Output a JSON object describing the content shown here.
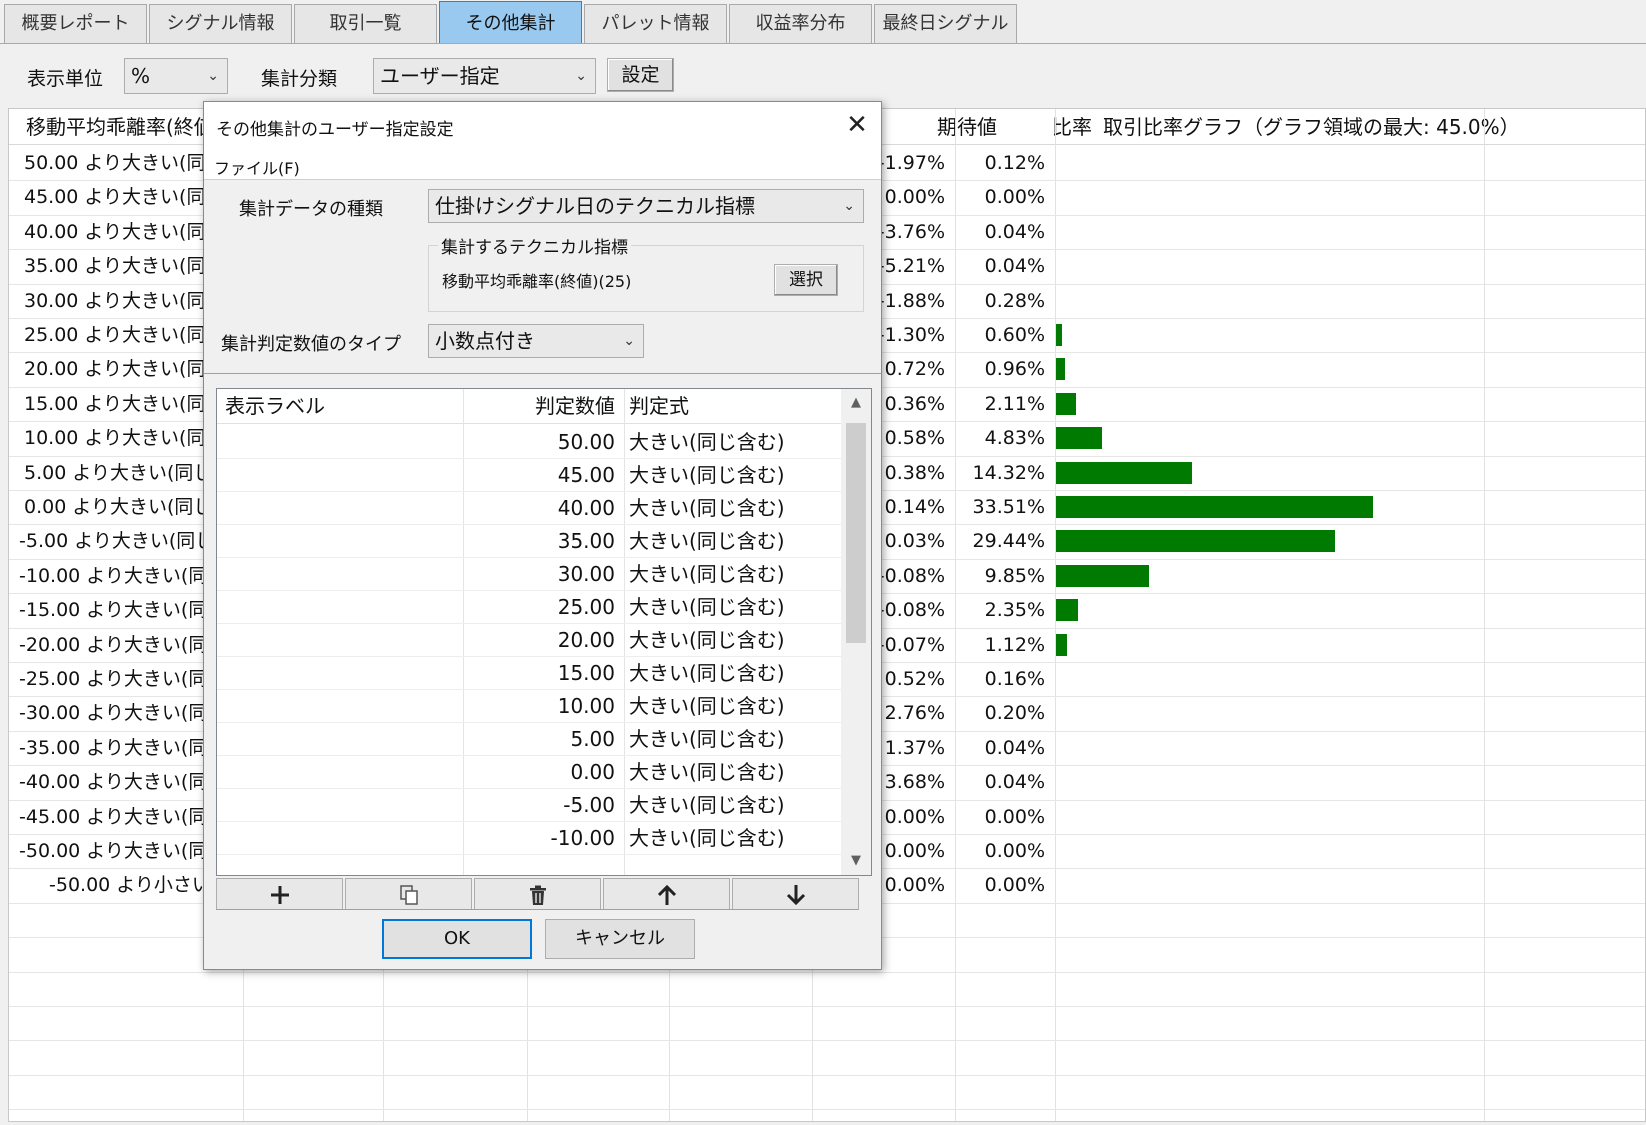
{
  "tabs": [
    "概要レポート",
    "シグナル情報",
    "取引一覧",
    "その他集計",
    "パレット情報",
    "収益率分布",
    "最終日シグナル"
  ],
  "active_tab": 3,
  "toolbar": {
    "unit_label": "表示単位",
    "unit_value": "%",
    "category_label": "集計分類",
    "category_value": "ユーザー指定",
    "settings_button": "設定"
  },
  "grid": {
    "headers": {
      "label": "移動平均乖離率(終値)(25)",
      "expected": "期待値",
      "ratio": "比率",
      "graph": "取引比率グラフ（グラフ領域の最大: 45.0%）"
    },
    "graph_max_pct": 45.0,
    "rows": [
      {
        "label": "50.00 より大きい(同じ含む)",
        "expected": "-1.97%",
        "ratio": "0.12%",
        "pct": 0.12
      },
      {
        "label": "45.00 より大きい(同じ含む)",
        "expected": "0.00%",
        "ratio": "0.00%",
        "pct": 0.0
      },
      {
        "label": "40.00 より大きい(同じ含む)",
        "expected": "-3.76%",
        "ratio": "0.04%",
        "pct": 0.04
      },
      {
        "label": "35.00 より大きい(同じ含む)",
        "expected": "-5.21%",
        "ratio": "0.04%",
        "pct": 0.04
      },
      {
        "label": "30.00 より大きい(同じ含む)",
        "expected": "-1.88%",
        "ratio": "0.28%",
        "pct": 0.28
      },
      {
        "label": "25.00 より大きい(同じ含む)",
        "expected": "-1.30%",
        "ratio": "0.60%",
        "pct": 0.6
      },
      {
        "label": "20.00 より大きい(同じ含む)",
        "expected": "0.72%",
        "ratio": "0.96%",
        "pct": 0.96
      },
      {
        "label": "15.00 より大きい(同じ含む)",
        "expected": "0.36%",
        "ratio": "2.11%",
        "pct": 2.11
      },
      {
        "label": "10.00 より大きい(同じ含む)",
        "expected": "0.58%",
        "ratio": "4.83%",
        "pct": 4.83
      },
      {
        "label": "5.00 より大きい(同じ含む)",
        "expected": "0.38%",
        "ratio": "14.32%",
        "pct": 14.32
      },
      {
        "label": "0.00 より大きい(同じ含む)",
        "expected": "0.14%",
        "ratio": "33.51%",
        "pct": 33.51
      },
      {
        "label": "-5.00 より大きい(同じ含む)",
        "expected": "0.03%",
        "ratio": "29.44%",
        "pct": 29.44
      },
      {
        "label": "-10.00 より大きい(同じ含む)",
        "expected": "-0.08%",
        "ratio": "9.85%",
        "pct": 9.85
      },
      {
        "label": "-15.00 より大きい(同じ含む)",
        "expected": "-0.08%",
        "ratio": "2.35%",
        "pct": 2.35
      },
      {
        "label": "-20.00 より大きい(同じ含む)",
        "expected": "-0.07%",
        "ratio": "1.12%",
        "pct": 1.12
      },
      {
        "label": "-25.00 より大きい(同じ含む)",
        "expected": "0.52%",
        "ratio": "0.16%",
        "pct": 0.16
      },
      {
        "label": "-30.00 より大きい(同じ含む)",
        "expected": "2.76%",
        "ratio": "0.20%",
        "pct": 0.2
      },
      {
        "label": "-35.00 より大きい(同じ含む)",
        "expected": "1.37%",
        "ratio": "0.04%",
        "pct": 0.04
      },
      {
        "label": "-40.00 より大きい(同じ含む)",
        "expected": "3.68%",
        "ratio": "0.04%",
        "pct": 0.04
      },
      {
        "label": "-45.00 より大きい(同じ含む)",
        "expected": "0.00%",
        "ratio": "0.00%",
        "pct": 0.0
      },
      {
        "label": "-50.00 より大きい(同じ含む)",
        "expected": "0.00%",
        "ratio": "0.00%",
        "pct": 0.0
      },
      {
        "label": "-50.00 より小さい",
        "expected": "0.00%",
        "ratio": "0.00%",
        "pct": 0.0
      }
    ]
  },
  "dialog": {
    "title": "その他集計のユーザー指定設定",
    "menu_file": "ファイル(F)",
    "data_type_label": "集計データの種類",
    "data_type_value": "仕掛けシグナル日のテクニカル指標",
    "indicator_group_label": "集計するテクニカル指標",
    "indicator_value": "移動平均乖離率(終値)(25)",
    "select_button": "選択",
    "value_type_label": "集計判定数値のタイプ",
    "value_type_value": "小数点付き",
    "list_headers": {
      "label": "表示ラベル",
      "value": "判定数値",
      "formula": "判定式"
    },
    "list_rows": [
      {
        "value": "50.00",
        "formula": "大きい(同じ含む)"
      },
      {
        "value": "45.00",
        "formula": "大きい(同じ含む)"
      },
      {
        "value": "40.00",
        "formula": "大きい(同じ含む)"
      },
      {
        "value": "35.00",
        "formula": "大きい(同じ含む)"
      },
      {
        "value": "30.00",
        "formula": "大きい(同じ含む)"
      },
      {
        "value": "25.00",
        "formula": "大きい(同じ含む)"
      },
      {
        "value": "20.00",
        "formula": "大きい(同じ含む)"
      },
      {
        "value": "15.00",
        "formula": "大きい(同じ含む)"
      },
      {
        "value": "10.00",
        "formula": "大きい(同じ含む)"
      },
      {
        "value": "5.00",
        "formula": "大きい(同じ含む)"
      },
      {
        "value": "0.00",
        "formula": "大きい(同じ含む)"
      },
      {
        "value": "-5.00",
        "formula": "大きい(同じ含む)"
      },
      {
        "value": "-10.00",
        "formula": "大きい(同じ含む)"
      }
    ],
    "tool_buttons": [
      "plus-icon",
      "copy-icon",
      "trash-icon",
      "arrow-up-icon",
      "arrow-down-icon"
    ],
    "ok_button": "OK",
    "cancel_button": "キャンセル"
  },
  "colors": {
    "bar": "#007a00",
    "active_tab": "#99c9ef",
    "focus": "#0078d7"
  }
}
